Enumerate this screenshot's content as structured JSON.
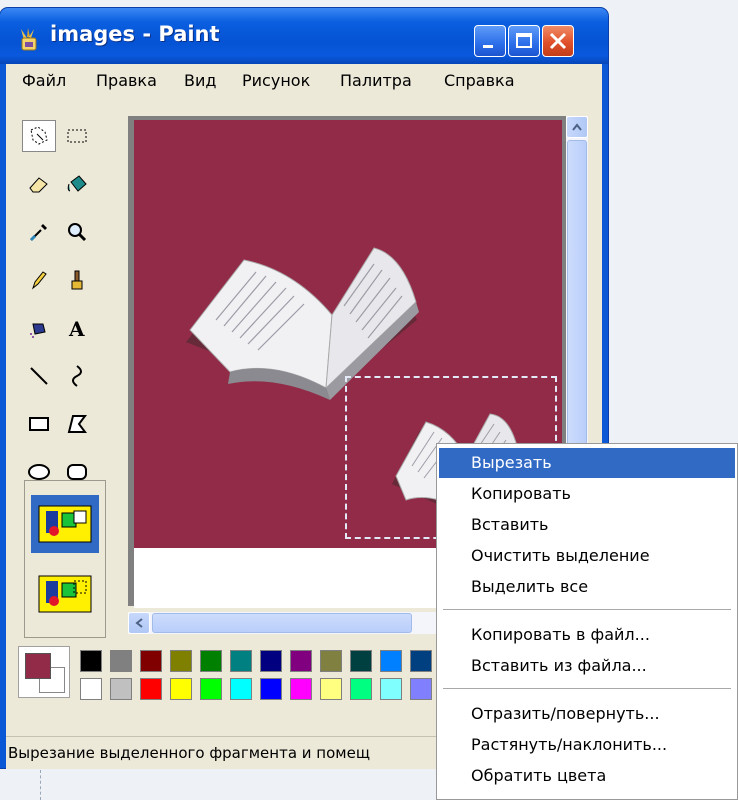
{
  "window": {
    "title": "images - Paint"
  },
  "menu": {
    "items": [
      "Файл",
      "Правка",
      "Вид",
      "Рисунок",
      "Палитра",
      "Справка"
    ]
  },
  "tools": [
    {
      "name": "free-form-select"
    },
    {
      "name": "rect-select"
    },
    {
      "name": "eraser"
    },
    {
      "name": "fill"
    },
    {
      "name": "pick-color"
    },
    {
      "name": "magnifier"
    },
    {
      "name": "pencil"
    },
    {
      "name": "brush"
    },
    {
      "name": "airbrush"
    },
    {
      "name": "text"
    },
    {
      "name": "line"
    },
    {
      "name": "curve"
    },
    {
      "name": "rectangle"
    },
    {
      "name": "polygon"
    },
    {
      "name": "ellipse"
    },
    {
      "name": "rounded-rectangle"
    }
  ],
  "palette": {
    "foreground": "#922b47",
    "background": "#ffffff",
    "row1": [
      "#000000",
      "#808080",
      "#800000",
      "#808000",
      "#008000",
      "#008080",
      "#000080",
      "#800080",
      "#808040",
      "#004040",
      "#0080ff",
      "#004080"
    ],
    "row2": [
      "#ffffff",
      "#c0c0c0",
      "#ff0000",
      "#ffff00",
      "#00ff00",
      "#00ffff",
      "#0000ff",
      "#ff00ff",
      "#ffff80",
      "#00ff80",
      "#80ffff",
      "#8080ff"
    ]
  },
  "canvas": {
    "background": "#922b47"
  },
  "status": {
    "text": "Вырезание выделенного фрагмента и помещ"
  },
  "context_menu": {
    "group1": [
      "Вырезать",
      "Копировать",
      "Вставить",
      "Очистить выделение",
      "Выделить все"
    ],
    "group2": [
      "Копировать в файл...",
      "Вставить из файла..."
    ],
    "group3": [
      "Отразить/повернуть...",
      "Растянуть/наклонить...",
      "Обратить цвета"
    ],
    "highlighted": "Вырезать"
  }
}
